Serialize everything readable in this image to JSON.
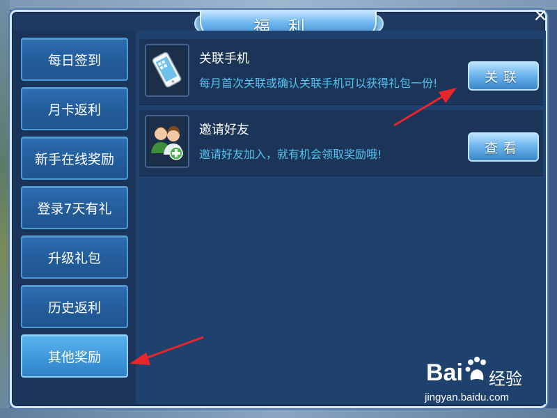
{
  "window": {
    "title": "福利",
    "close_icon": "×"
  },
  "sidebar": {
    "items": [
      {
        "label": "每日签到"
      },
      {
        "label": "月卡返利"
      },
      {
        "label": "新手在线奖励"
      },
      {
        "label": "登录7天有礼"
      },
      {
        "label": "升级礼包"
      },
      {
        "label": "历史返利"
      },
      {
        "label": "其他奖励",
        "active": true
      }
    ]
  },
  "rewards": [
    {
      "icon": "phone-icon",
      "title": "关联手机",
      "desc": "每月首次关联或确认关联手机可以获得礼包一份!",
      "button": "关联"
    },
    {
      "icon": "invite-friends-icon",
      "title": "邀请好友",
      "desc": "邀请好友加入，就有机会领取奖励哦!",
      "button": "查看"
    }
  ],
  "watermark": {
    "logo": "Bai",
    "logo_suffix_icon": "baidu-paw-icon",
    "text": "经验",
    "url": "jingyan.baidu.com"
  },
  "colors": {
    "panel": "#1e3a63",
    "button": "#2d6eb2",
    "active_button": "#5ab3ee",
    "desc_text": "#55c3f0",
    "annotation_arrow": "#e8262b"
  }
}
